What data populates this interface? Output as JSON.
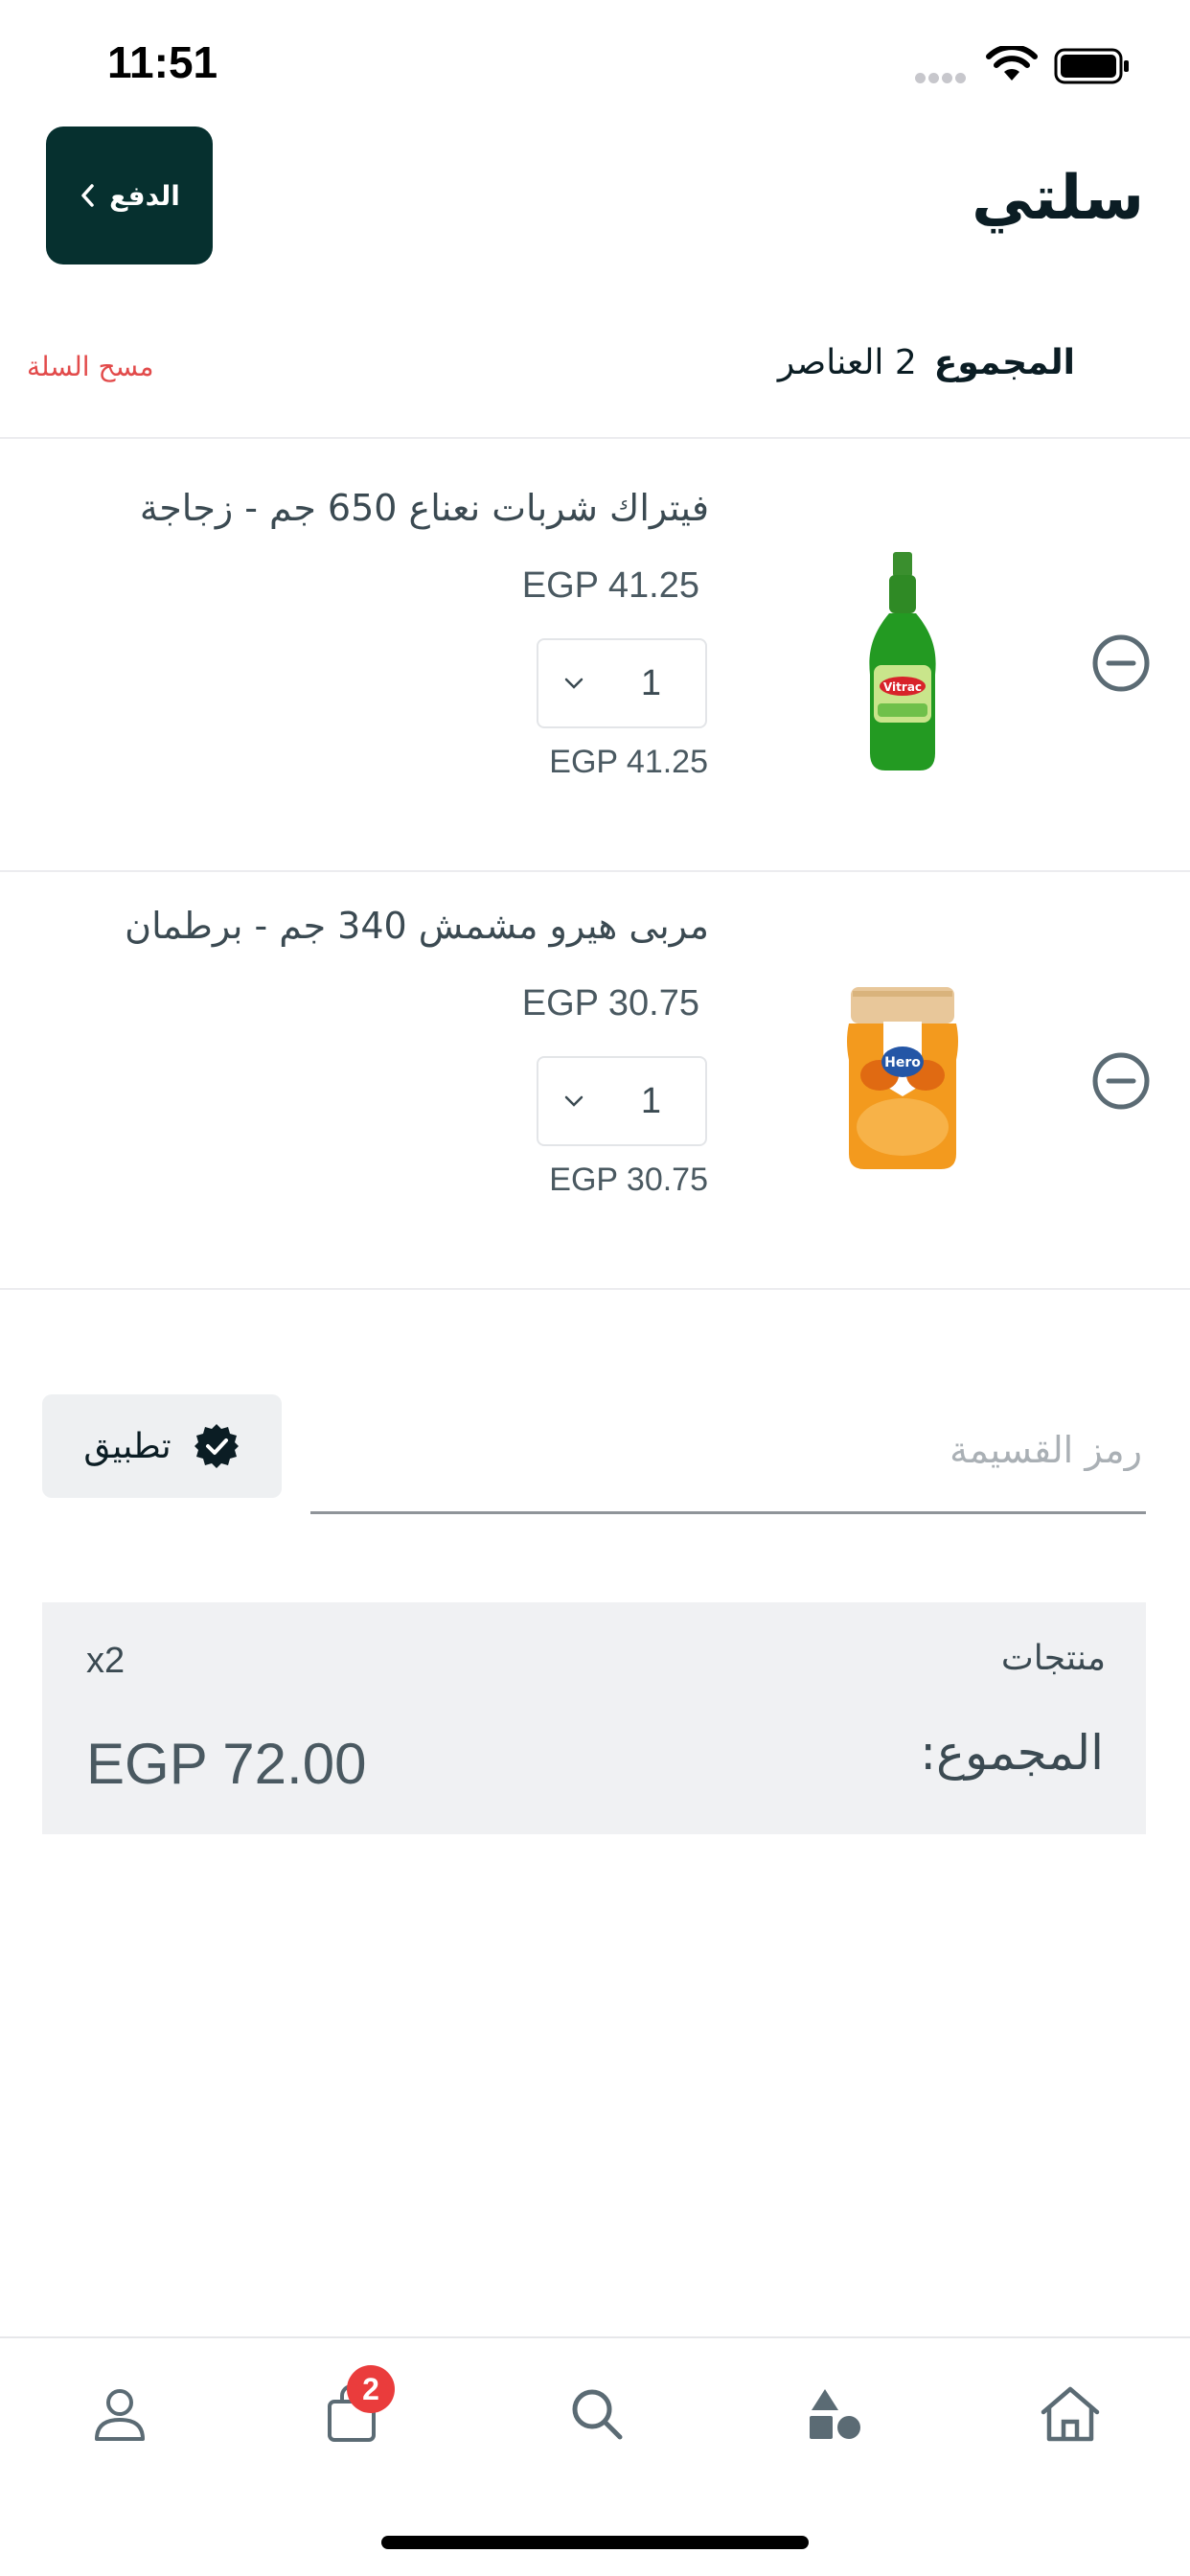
{
  "status_bar": {
    "time": "11:51"
  },
  "header": {
    "title": "سلتي",
    "checkout_label": "الدفع"
  },
  "summary": {
    "total_label": "المجموع",
    "items_text": "2 العناصر",
    "clear_cart_label": "مسح السلة"
  },
  "items": [
    {
      "name": "فيتراك شربات نعناع 650 جم - زجاجة",
      "price": "EGP 41.25",
      "quantity": "1",
      "line_total": "EGP  41.25",
      "image": "green-syrup-bottle"
    },
    {
      "name": "مربى هيرو مشمش  340 جم - برطمان",
      "price": "EGP 30.75",
      "quantity": "1",
      "line_total": "EGP  30.75",
      "image": "apricot-jam-jar"
    }
  ],
  "coupon": {
    "placeholder": "رمز القسيمة",
    "apply_label": "تطبيق"
  },
  "totals": {
    "products_label": "منتجات",
    "products_count": "x2",
    "total_label": "المجموع:",
    "total_value": "EGP 72.00"
  },
  "nav": {
    "items": [
      "home-icon",
      "categories-icon",
      "search-icon",
      "cart-icon",
      "profile-icon"
    ],
    "cart_badge": "2"
  },
  "colors": {
    "primary": "#06302f",
    "danger": "#e24b4b",
    "badge": "#ea3c3c",
    "text": "#3b4a52"
  }
}
